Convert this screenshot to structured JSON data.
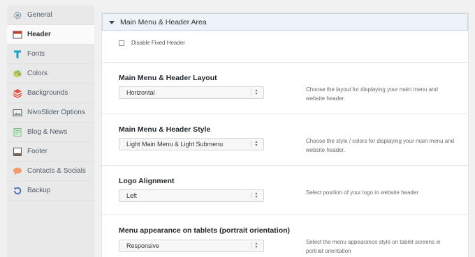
{
  "sidebar": {
    "items": [
      {
        "label": "General",
        "icon": "gear-icon",
        "color": "#8aa0b3"
      },
      {
        "label": "Header",
        "icon": "header-icon",
        "color": "#c0392b",
        "active": true
      },
      {
        "label": "Fonts",
        "icon": "font-icon",
        "color": "#1aa1c7"
      },
      {
        "label": "Colors",
        "icon": "palette-icon",
        "color": "#8fbf3a"
      },
      {
        "label": "Backgrounds",
        "icon": "layers-icon",
        "color": "#e74c3c"
      },
      {
        "label": "NivoSlider Options",
        "icon": "slider-icon",
        "color": "#7f8c8d"
      },
      {
        "label": "Blog & News",
        "icon": "blog-icon",
        "color": "#7fb98a"
      },
      {
        "label": "Footer",
        "icon": "footer-icon",
        "color": "#7b6a5a"
      },
      {
        "label": "Contacts & Socials",
        "icon": "chat-icon",
        "color": "#f39c6b"
      },
      {
        "label": "Backup",
        "icon": "backup-icon",
        "color": "#3b6fb6"
      }
    ]
  },
  "section": {
    "title": "Main Menu & Header Area"
  },
  "checkbox": {
    "label": "Disable Fixed Header",
    "checked": false
  },
  "fields": [
    {
      "title": "Main Menu & Header Layout",
      "value": "Horizontal",
      "desc": "Choose the layout for displaying your main menu and website header."
    },
    {
      "title": "Main Menu & Header Style",
      "value": "Light Main Menu & Light Submenu",
      "desc": "Choose the style / colors for displaying your main menu and website header."
    },
    {
      "title": "Logo Alignment",
      "value": "Left",
      "desc": "Select position of your logo in website header"
    },
    {
      "title": "Menu appearance on tablets (portrait orientation)",
      "value": "Responsive",
      "desc": "Select the menu appearance style on tablet screens in portrait orientation"
    }
  ]
}
